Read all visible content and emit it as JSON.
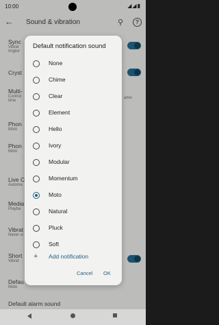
{
  "status": {
    "time": "10:00",
    "icons": "◢◢▮"
  },
  "appbar": {
    "title": "Sound & vibration",
    "back_glyph": "←",
    "search_glyph": "⚲",
    "help_glyph": "?"
  },
  "background": {
    "items": [
      {
        "title": "Sync",
        "sub": "Vibrat",
        "sub2": "ringtor"
      },
      {
        "title": "Cryst",
        "sub": "",
        "sub2": ""
      },
      {
        "title": "Multi-",
        "sub": "Control",
        "sub2": "time"
      },
      {
        "title": "Phon",
        "sub": "Moto",
        "sub2": ""
      },
      {
        "title": "Phon",
        "sub": "Moto",
        "sub2": ""
      },
      {
        "title": "Live C",
        "sub": "Automa",
        "sub2": ""
      },
      {
        "title": "Media",
        "sub": "Playba",
        "sub2": ""
      },
      {
        "title": "Vibrat",
        "sub": "Never vi",
        "sub2": ""
      },
      {
        "title": "Short",
        "sub": "Vibrat",
        "sub2": ""
      },
      {
        "title": "Defau",
        "sub": "Moto",
        "sub2": ""
      },
      {
        "title": "Default alarm sound",
        "sub": "",
        "sub2": ""
      }
    ],
    "side_text": "ame"
  },
  "dialog": {
    "title": "Default notification sound",
    "options": [
      "None",
      "Chime",
      "Clear",
      "Element",
      "Hello",
      "Ivory",
      "Modular",
      "Momentum",
      "Moto",
      "Natural",
      "Pluck",
      "Soft"
    ],
    "selected": "Moto",
    "add_label": "Add notification",
    "plus_glyph": "+",
    "cancel_label": "Cancel",
    "ok_label": "OK"
  },
  "colors": {
    "accent": "#1f5f80",
    "background": "#d7d7d5",
    "dialog": "#f2f2f0"
  }
}
